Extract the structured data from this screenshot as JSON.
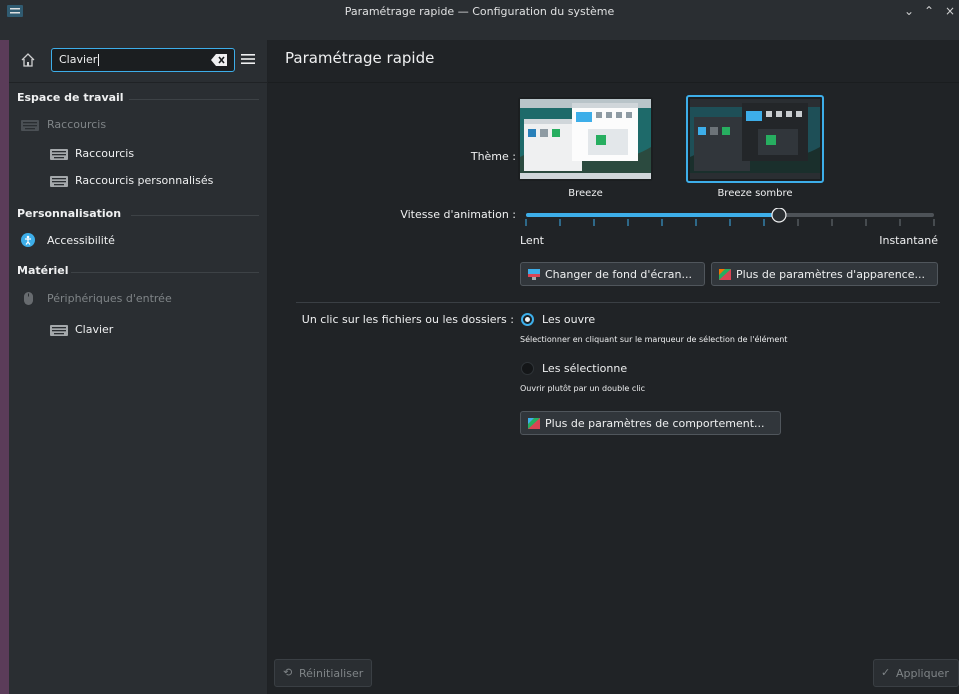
{
  "window": {
    "title": "Paramétrage rapide — Configuration du système",
    "controls": {
      "minimize": "⌄",
      "maximize": "⌃",
      "close": "×"
    }
  },
  "sidebar": {
    "search": {
      "value": "Clavier"
    },
    "sections": [
      {
        "label": "Espace de travail"
      },
      {
        "label": "Personnalisation"
      },
      {
        "label": "Matériel"
      }
    ],
    "items": [
      {
        "label": "Raccourcis",
        "dimmed": true,
        "icon": "keyboard-icon"
      },
      {
        "label": "Raccourcis",
        "dimmed": false,
        "icon": "keyboard-icon"
      },
      {
        "label": "Raccourcis personnalisés",
        "dimmed": false,
        "icon": "keyboard-icon"
      },
      {
        "label": "Accessibilité",
        "dimmed": false,
        "icon": "accessibility-icon"
      },
      {
        "label": "Périphériques d'entrée",
        "dimmed": true,
        "icon": "mouse-icon"
      },
      {
        "label": "Clavier",
        "dimmed": false,
        "icon": "keyboard-icon"
      }
    ]
  },
  "main": {
    "page_title": "Paramétrage rapide",
    "theme": {
      "label": "Thème :",
      "options": [
        {
          "name": "Breeze",
          "selected": false
        },
        {
          "name": "Breeze sombre",
          "selected": true
        }
      ]
    },
    "animation": {
      "label": "Vitesse d'animation :",
      "min_label": "Lent",
      "max_label": "Instantané",
      "value_fraction": 0.62,
      "ticks": 13
    },
    "buttons": {
      "wallpaper": "Changer de fond d'écran...",
      "appearance": "Plus de paramètres d'apparence...",
      "behavior": "Plus de paramètres de comportement..."
    },
    "click": {
      "label": "Un clic sur les fichiers ou les dossiers :",
      "options": [
        {
          "label": "Les ouvre",
          "hint": "Sélectionner en cliquant sur le marqueur de sélection de l'élément",
          "checked": true
        },
        {
          "label": "Les sélectionne",
          "hint": "Ouvrir plutôt par un double clic",
          "checked": false
        }
      ]
    },
    "footer": {
      "reset": "Réinitialiser",
      "apply": "Appliquer"
    }
  },
  "colors": {
    "accent": "#3daee9",
    "window_bg": "#202326",
    "sidebar_bg": "#2a2e32"
  }
}
